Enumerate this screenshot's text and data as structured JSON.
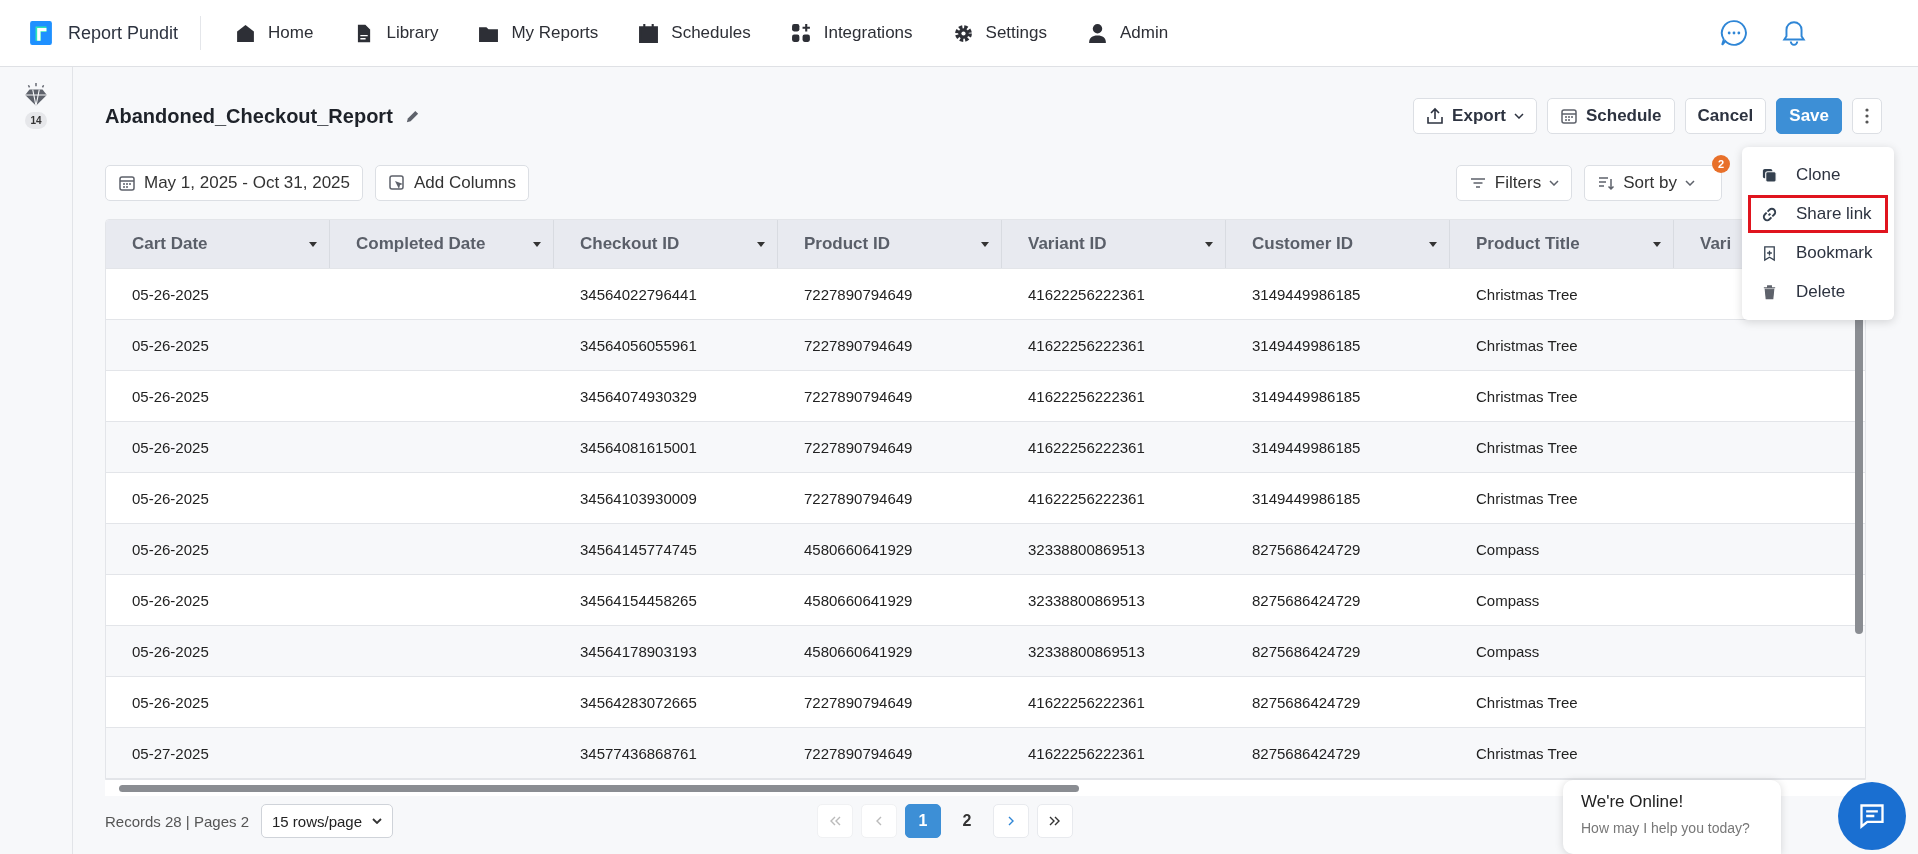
{
  "brand": {
    "name": "Report Pundit"
  },
  "nav": [
    {
      "label": "Home",
      "kind": "home"
    },
    {
      "label": "Library",
      "kind": "file"
    },
    {
      "label": "My Reports",
      "kind": "folder"
    },
    {
      "label": "Schedules",
      "kind": "calendar"
    },
    {
      "label": "Integrations",
      "kind": "apps"
    },
    {
      "label": "Settings",
      "kind": "gear"
    },
    {
      "label": "Admin",
      "kind": "user"
    }
  ],
  "sidebar": {
    "badge": "14"
  },
  "report": {
    "title": "Abandoned_Checkout_Report"
  },
  "actions": [
    {
      "label": "Export",
      "kind": "export"
    },
    {
      "label": "Schedule",
      "kind": "schedule"
    },
    {
      "label": "Cancel",
      "kind": "plain"
    },
    {
      "label": "Save",
      "kind": "primary"
    }
  ],
  "date_range": "May 1, 2025 - Oct 31, 2025",
  "add_columns": "Add Columns",
  "filters": "Filters",
  "sort": {
    "label": "Sort by",
    "badge": "2"
  },
  "menu": [
    {
      "label": "Clone",
      "kind": "clone",
      "selected": false
    },
    {
      "label": "Share link",
      "kind": "link",
      "selected": true
    },
    {
      "label": "Bookmark",
      "kind": "bookmark",
      "selected": false
    },
    {
      "label": "Delete",
      "kind": "trash",
      "selected": false
    }
  ],
  "table": {
    "columns": [
      "Cart Date",
      "Completed Date",
      "Checkout ID",
      "Product ID",
      "Variant ID",
      "Customer ID",
      "Product Title",
      "Vari"
    ],
    "rows": [
      [
        "05-26-2025",
        null,
        "34564022796441",
        "7227890794649",
        "41622256222361",
        "3149449986185",
        "Christmas Tree"
      ],
      [
        "05-26-2025",
        null,
        "34564056055961",
        "7227890794649",
        "41622256222361",
        "3149449986185",
        "Christmas Tree"
      ],
      [
        "05-26-2025",
        null,
        "34564074930329",
        "7227890794649",
        "41622256222361",
        "3149449986185",
        "Christmas Tree"
      ],
      [
        "05-26-2025",
        null,
        "34564081615001",
        "7227890794649",
        "41622256222361",
        "3149449986185",
        "Christmas Tree"
      ],
      [
        "05-26-2025",
        null,
        "34564103930009",
        "7227890794649",
        "41622256222361",
        "3149449986185",
        "Christmas Tree"
      ],
      [
        "05-26-2025",
        null,
        "34564145774745",
        "4580660641929",
        "32338800869513",
        "8275686424729",
        "Compass"
      ],
      [
        "05-26-2025",
        null,
        "34564154458265",
        "4580660641929",
        "32338800869513",
        "8275686424729",
        "Compass"
      ],
      [
        "05-26-2025",
        null,
        "34564178903193",
        "4580660641929",
        "32338800869513",
        "8275686424729",
        "Compass"
      ],
      [
        "05-26-2025",
        null,
        "34564283072665",
        "7227890794649",
        "41622256222361",
        "8275686424729",
        "Christmas Tree"
      ],
      [
        "05-27-2025",
        null,
        "34577436868761",
        "7227890794649",
        "41622256222361",
        "8275686424729",
        "Christmas Tree"
      ]
    ]
  },
  "footer": {
    "records": "Records 28 | Pages 2",
    "page_size": "15 rows/page"
  },
  "pagination": [
    {
      "label": "1",
      "selected": true
    },
    {
      "label": "2",
      "selected": false
    }
  ],
  "chat": {
    "title": "We're Online!",
    "subtitle": "How may I help you today?"
  }
}
